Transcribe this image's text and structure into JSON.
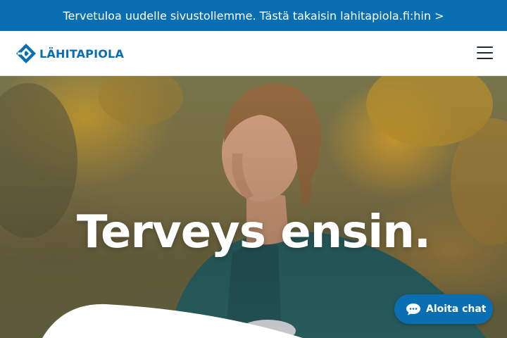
{
  "banner": {
    "text": "Tervetuloa uudelle sivustollemme. Tästä takaisin lahitapiola.fi:hin >"
  },
  "header": {
    "logo_text": "LÄHITAPIOLA",
    "logo_icon": "lahitapiola-logo-mark",
    "menu_icon": "hamburger-menu-icon"
  },
  "hero": {
    "title": "Terveys ensin.",
    "image": "woman-jogger-autumn-photo"
  },
  "chat": {
    "label": "Aloita chat",
    "icon": "chat-bubble-icon"
  },
  "colors": {
    "brand": "#0a6fb2",
    "text": "#1f2a33",
    "background": "#ffffff"
  }
}
